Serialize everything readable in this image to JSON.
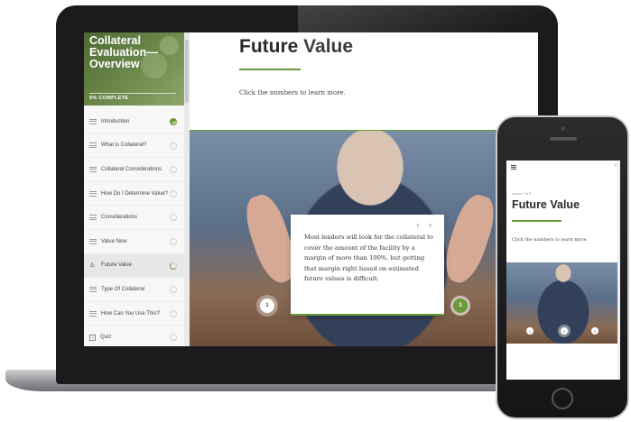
{
  "course": {
    "title": "Collateral Evaluation—Overview",
    "progress": "9% COMPLETE"
  },
  "menu": [
    {
      "label": "Introduction",
      "status": "done",
      "icon": "lines-icon"
    },
    {
      "label": "What is Collateral?",
      "status": "todo",
      "icon": "lines-icon"
    },
    {
      "label": "Collateral Considerations",
      "status": "todo",
      "icon": "lines-icon"
    },
    {
      "label": "How Do I Determine Value?",
      "status": "todo",
      "icon": "lines-icon"
    },
    {
      "label": "Considerations",
      "status": "todo",
      "icon": "lines-icon"
    },
    {
      "label": "Value Now",
      "status": "todo",
      "icon": "lines-icon"
    },
    {
      "label": "Future Value",
      "status": "in-progress",
      "icon": "person-icon"
    },
    {
      "label": "Type Of Collateral",
      "status": "todo",
      "icon": "lines-icon"
    },
    {
      "label": "How Can You Use This?",
      "status": "todo",
      "icon": "lines-icon"
    },
    {
      "label": "Quiz",
      "status": "todo",
      "icon": "quiz-icon"
    }
  ],
  "main": {
    "title": "Future Value",
    "instruction": "Click the numbers to learn more.",
    "hotspot_left": "1",
    "hotspot_right": "3",
    "popover_nav": "‹ ›",
    "popover_text": "Most lenders will look for the collateral to cover the amount of the facility by a margin of more than 100%, but getting that margin right based on estimated future values is difficult."
  },
  "phone": {
    "counter": "Lesson 7 of 9",
    "title": "Future Value",
    "instruction": "Click the numbers to learn more.",
    "dot1": "1",
    "dot2": "2",
    "dot3": "3"
  },
  "colors": {
    "accent": "#6a9a3a"
  }
}
